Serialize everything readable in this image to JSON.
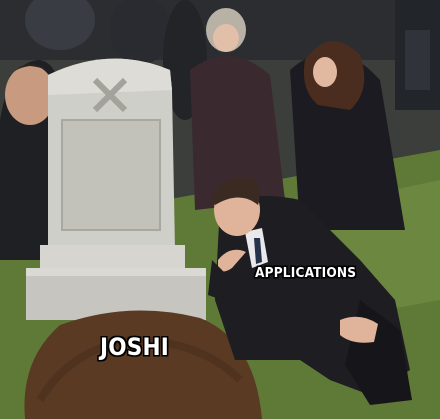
{
  "meme": {
    "template": "grave-pointing",
    "captions": {
      "grave_dirt": "JOSHI",
      "man": "APPLICATIONS"
    },
    "colors": {
      "grass": "#5f7a37",
      "dirt": "#5b3a24",
      "tombstone": "#cfcfc9",
      "coat": "#1d1d22",
      "skin": "#e0b49a",
      "caption_fill": "#ffffff",
      "caption_outline": "#000000"
    }
  }
}
